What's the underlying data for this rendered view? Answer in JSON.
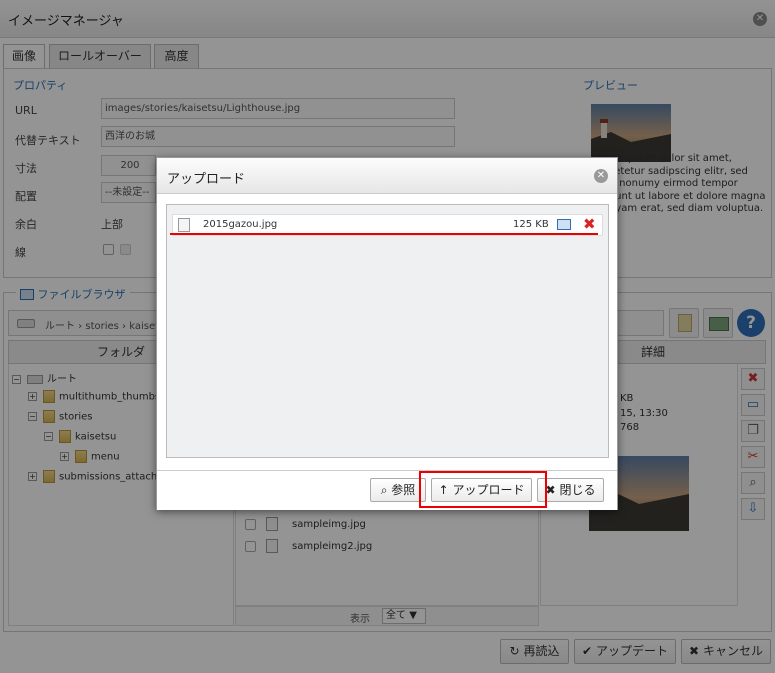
{
  "window": {
    "title": "イメージマネージャ"
  },
  "tabs": [
    {
      "label": "画像"
    },
    {
      "label": "ロールオーバー"
    },
    {
      "label": "高度"
    }
  ],
  "properties": {
    "heading": "プロパティ",
    "url_label": "URL",
    "url_value": "images/stories/kaisetsu/Lighthouse.jpg",
    "alt_label": "代替テキスト",
    "alt_value": "西洋のお城",
    "size_label": "寸法",
    "size_width": "200",
    "align_label": "配置",
    "align_value": "--未設定--",
    "margin_label": "余白",
    "margin_top_label": "上部",
    "border_label": "線"
  },
  "preview": {
    "heading": "プレビュー",
    "lorem": "Lorem ipsum dolor sit amet, consetetur sadipscing elitr, sed diam nonumy eirmod tempor invidunt ut labore et dolore magna aliquyam erat, sed diam voluptua."
  },
  "browser": {
    "heading": "ファイルブラウザ",
    "path": "ルート › stories › kaisetsu",
    "folder_header": "フォルダ",
    "detail_header": "詳細",
    "tree": [
      {
        "label": "ルート"
      },
      {
        "label": "multithumb_thumbs"
      },
      {
        "label": "stories"
      },
      {
        "label": "kaisetsu"
      },
      {
        "label": "menu"
      },
      {
        "label": "submissions_attach"
      }
    ],
    "files": [
      {
        "name": "sampleimg.jpg"
      },
      {
        "name": "sampleimg2.jpg"
      }
    ],
    "show_label": "表示",
    "show_value": "全て",
    "details": {
      "size": "KB",
      "date": "15, 13:30",
      "dims": "768"
    }
  },
  "footer": {
    "reload": "再読込",
    "update": "アップデート",
    "cancel": "キャンセル"
  },
  "upload_dialog": {
    "title": "アップロード",
    "file": {
      "name": "2015gazou.jpg",
      "size": "125 KB"
    },
    "browse": "参照",
    "upload": "アップロード",
    "close": "閉じる"
  },
  "colors": {
    "accent": "#2a6fb5",
    "highlight": "#ee0000"
  }
}
